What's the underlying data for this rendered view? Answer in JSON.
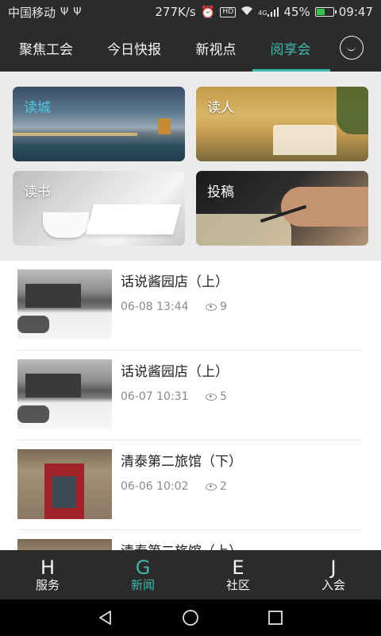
{
  "status_bar": {
    "carrier": "中国移动",
    "speed": "277K/s",
    "hd": "HD",
    "network": "4G",
    "battery": "45%",
    "battery_level": 0.45,
    "time": "09:47"
  },
  "top_tabs": [
    {
      "label": "聚焦工会",
      "active": false
    },
    {
      "label": "今日快报",
      "active": false
    },
    {
      "label": "新视点",
      "active": false
    },
    {
      "label": "阅享会",
      "active": true
    }
  ],
  "categories": [
    {
      "label": "读城"
    },
    {
      "label": "读人"
    },
    {
      "label": "读书"
    },
    {
      "label": "投稿"
    }
  ],
  "news": [
    {
      "title": "话说酱园店（上）",
      "date": "06-08 13:44",
      "views": "9"
    },
    {
      "title": "话说酱园店（上）",
      "date": "06-07 10:31",
      "views": "5"
    },
    {
      "title": "清泰第二旅馆（下）",
      "date": "06-06 10:02",
      "views": "2"
    },
    {
      "title": "清泰第二旅馆（上）",
      "date": "",
      "views": ""
    }
  ],
  "bottom_nav": [
    {
      "glyph": "H",
      "label": "服务",
      "active": false
    },
    {
      "glyph": "G",
      "label": "新闻",
      "active": true
    },
    {
      "glyph": "E",
      "label": "社区",
      "active": false
    },
    {
      "glyph": "J",
      "label": "入会",
      "active": false
    }
  ],
  "colors": {
    "accent": "#3fb7ae",
    "bar_bg": "#2b2b2b"
  }
}
